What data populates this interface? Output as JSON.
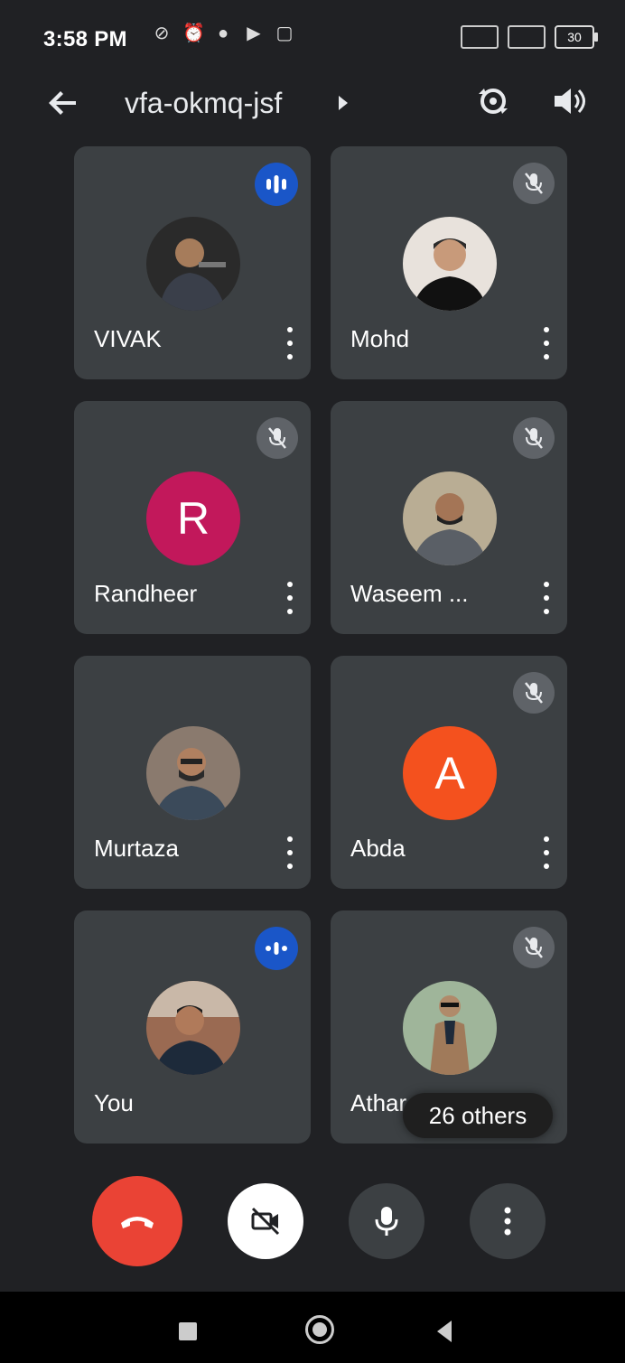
{
  "status_bar": {
    "time": "3:58 PM",
    "battery": "30"
  },
  "top_bar": {
    "meeting_code": "vfa-okmq-jsf"
  },
  "participants": [
    {
      "name": "VIVAK",
      "state": "speaking",
      "avatar": "photo"
    },
    {
      "name": "Mohd",
      "state": "muted",
      "avatar": "photo"
    },
    {
      "name": "Randheer",
      "state": "muted",
      "avatar_letter": "R",
      "avatar_color": "#c2185b"
    },
    {
      "name": "Waseem ...",
      "state": "muted",
      "avatar": "photo"
    },
    {
      "name": "Murtaza",
      "state": "none",
      "avatar": "photo"
    },
    {
      "name": "Abda",
      "state": "muted",
      "avatar_letter": "A",
      "avatar_color": "#f4511e"
    },
    {
      "name": "You",
      "state": "speaking",
      "avatar": "photo"
    },
    {
      "name": "Athar",
      "state": "muted",
      "avatar": "photo"
    }
  ],
  "others_chip": "26 others",
  "colors": {
    "end_call": "#ea4335",
    "speaking_badge": "#1a56c8",
    "tile_bg": "#3c4043"
  }
}
